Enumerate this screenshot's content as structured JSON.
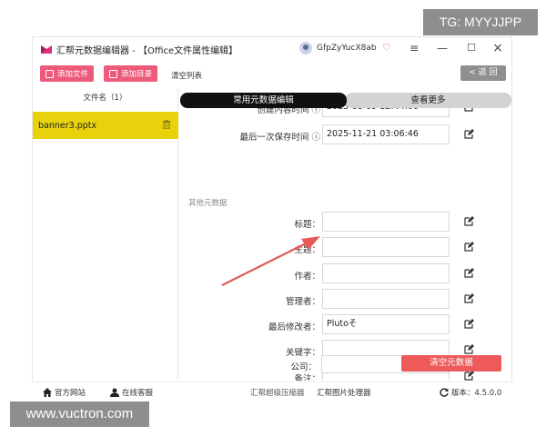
{
  "watermarks": {
    "top": "TG: MYYJJPP",
    "bottom": "www.vuctron.com"
  },
  "window": {
    "title": "汇帮元数据编辑器 - 【Office文件属性编辑】",
    "username": "GfpZyYucX8ab",
    "controls": {
      "menu": "≡",
      "minimize": "—",
      "maximize": "☐",
      "close": "×"
    }
  },
  "toolbar": {
    "add_file": "添加文件",
    "add_folder": "添加目录",
    "clear_list": "清空列表",
    "back": "< 返 回"
  },
  "file_list": {
    "header": "文件名（1）",
    "items": [
      {
        "name": "banner3.pptx"
      }
    ]
  },
  "tabs": {
    "common": "常用元数据编辑",
    "more": "查看更多"
  },
  "fields": {
    "created_time": {
      "label": "创建内容时间",
      "value": "2025-08-09 12:44:00"
    },
    "saved_time": {
      "label": "最后一次保存时间",
      "value": "2025-11-21 03:06:46"
    },
    "section_other": "其他元数据",
    "title": {
      "label": "标题：",
      "value": ""
    },
    "subject": {
      "label": "主题：",
      "value": ""
    },
    "author": {
      "label": "作者：",
      "value": ""
    },
    "manager": {
      "label": "管理者：",
      "value": ""
    },
    "last_modifier": {
      "label": "最后修改者：",
      "value": "Plutoそ"
    },
    "keywords": {
      "label": "关键字：",
      "value": ""
    },
    "notes": {
      "label": "备注：",
      "value": ""
    },
    "company": {
      "label": "公司：",
      "value": ""
    },
    "clear_metadata": "清空元数据"
  },
  "statusbar": {
    "website": "官方网站",
    "service": "在线客服",
    "compressor": "汇帮超级压缩器",
    "image_tool": "汇帮图片处理器",
    "version": "版本：4.5.0.0"
  },
  "colors": {
    "accent_pink": "#ee5a7a",
    "selected_row": "#e7d20c",
    "danger": "#ee5a5a",
    "arrow": "#e55b55"
  }
}
